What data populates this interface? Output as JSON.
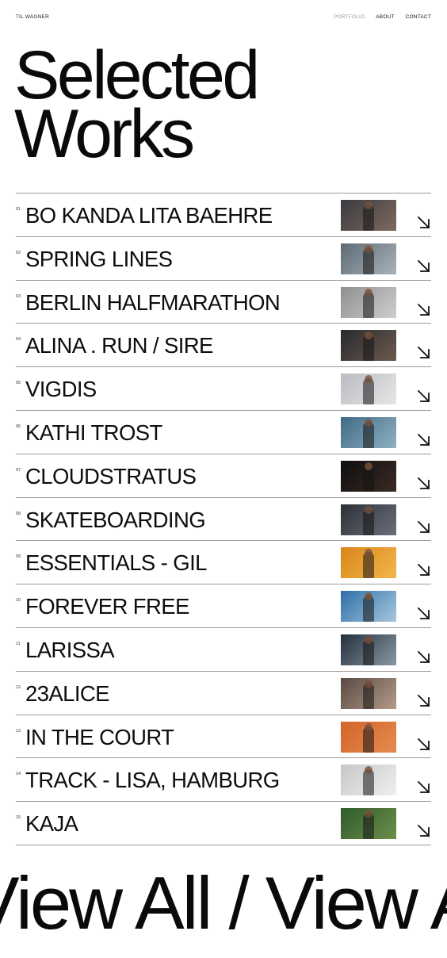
{
  "header": {
    "brand": "TIL WAGNER",
    "nav": [
      {
        "label": "PORTFOLIO",
        "active": true
      },
      {
        "label": "ABOUT",
        "active": false
      },
      {
        "label": "CONTACT",
        "active": false
      }
    ]
  },
  "hero": {
    "line1": "Selected",
    "line2": "Works"
  },
  "works": [
    {
      "num": "01",
      "title": "BO KANDA LITA BAEHRE",
      "thumb_colors": [
        "#3a3a40",
        "#7d6a5e"
      ]
    },
    {
      "num": "02",
      "title": "SPRING LINES",
      "thumb_colors": [
        "#5d6a74",
        "#a9b2ba"
      ]
    },
    {
      "num": "03",
      "title": "BERLIN HALFMARATHON",
      "thumb_colors": [
        "#8e8e8e",
        "#cfcfcf"
      ]
    },
    {
      "num": "04",
      "title": "ALINA . RUN / SIRE",
      "thumb_colors": [
        "#2a2a2e",
        "#6b5a4f"
      ]
    },
    {
      "num": "05",
      "title": "VIGDIS",
      "thumb_colors": [
        "#b9bcc2",
        "#e6e6e6"
      ]
    },
    {
      "num": "06",
      "title": "KATHI TROST",
      "thumb_colors": [
        "#3f6a86",
        "#8fb1c2"
      ]
    },
    {
      "num": "07",
      "title": "CLOUDSTRATUS",
      "thumb_colors": [
        "#0e0e0e",
        "#3a2a24"
      ]
    },
    {
      "num": "08",
      "title": "SKATEBOARDING",
      "thumb_colors": [
        "#2d3036",
        "#6a6f7a"
      ]
    },
    {
      "num": "09",
      "title": "ESSENTIALS - GIL",
      "thumb_colors": [
        "#d9861a",
        "#f2b64a"
      ]
    },
    {
      "num": "10",
      "title": "FOREVER FREE",
      "thumb_colors": [
        "#2e6fa8",
        "#a6c7de"
      ]
    },
    {
      "num": "11",
      "title": "LARISSA",
      "thumb_colors": [
        "#23303a",
        "#8a98a6"
      ]
    },
    {
      "num": "12",
      "title": "23ALICE",
      "thumb_colors": [
        "#5a4a42",
        "#b39a8a"
      ]
    },
    {
      "num": "13",
      "title": "IN THE COURT",
      "thumb_colors": [
        "#d2652a",
        "#e58a4e"
      ]
    },
    {
      "num": "14",
      "title": "TRACK - LISA, HAMBURG",
      "thumb_colors": [
        "#c7c7c7",
        "#efefef"
      ]
    },
    {
      "num": "15",
      "title": "KAJA",
      "thumb_colors": [
        "#2f5a2c",
        "#6d8f4a"
      ]
    }
  ],
  "marquee": {
    "text": "View All / View All / View All"
  }
}
